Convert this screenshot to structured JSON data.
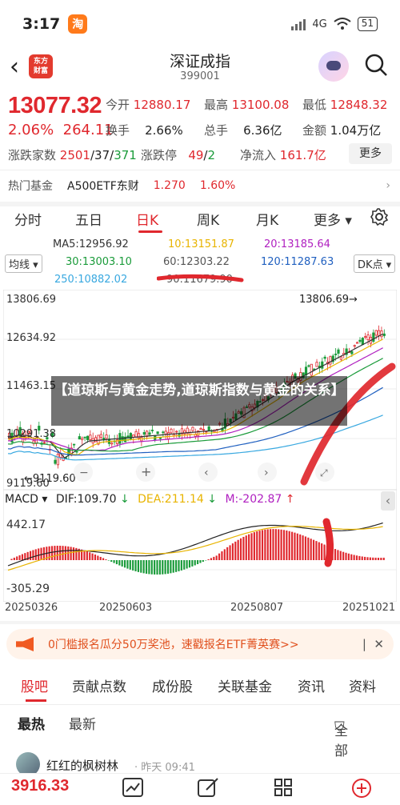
{
  "status": {
    "time": "3:17",
    "app_badge": "淘",
    "network": "4G",
    "battery": "51"
  },
  "nav": {
    "title": "深证成指",
    "code": "399001",
    "logo_text": "东方财富"
  },
  "quote": {
    "price": "13077.32",
    "change_pct": "2.06%",
    "change": "264.11",
    "open_label": "今开",
    "open": "12880.17",
    "high_label": "最高",
    "high": "13100.08",
    "low_label": "最低",
    "low": "12848.32",
    "turnover_label": "换手",
    "turnover": "2.66%",
    "volume_label": "总手",
    "volume": "6.36亿",
    "amount_label": "金额",
    "amount": "1.04万亿",
    "breadth_label": "涨跌家数",
    "breadth_up": "2501",
    "breadth_flat": "37",
    "breadth_down": "371",
    "limit_label": "涨跌停",
    "limit_up": "49",
    "limit_down": "2",
    "inflow_label": "净流入",
    "inflow": "161.7亿",
    "more_label": "更多"
  },
  "fund": {
    "label": "热门基金",
    "name": "A500ETF东财",
    "price": "1.270",
    "pct": "1.60%"
  },
  "tabs": [
    "分时",
    "五日",
    "日K",
    "周K",
    "月K",
    "更多"
  ],
  "ma": {
    "selector": "均线",
    "ma5": "MA5:12956.92",
    "ma10": "10:13151.87",
    "ma20": "20:13185.64",
    "ma30": "30:13003.10",
    "ma60": "60:12303.22",
    "ma120": "120:11287.63",
    "ma250": "250:10882.02",
    "ma90": "90:11679.90",
    "dk": "DK点"
  },
  "kchart": {
    "y_labels": [
      "13806.69",
      "12634.92",
      "11463.15",
      "10291.38",
      "9119.60"
    ],
    "high_label": "13806.69",
    "low_label": "9119.60"
  },
  "macd": {
    "selector": "MACD",
    "dif": "DIF:109.70",
    "dea": "DEA:211.14",
    "m": "M:-202.87",
    "top": "442.17",
    "bottom": "-305.29"
  },
  "dates": [
    "20250326",
    "20250603",
    "20250807",
    "20251021"
  ],
  "overlay": {
    "title": "【道琼斯与黄金走势,道琼斯指数与黄金的关系】"
  },
  "promo": {
    "text": "0门槛报名瓜分50万奖池，速戳报名ETF菁英赛>>"
  },
  "sub_tabs": [
    "股吧",
    "贡献点数",
    "成份股",
    "关联基金",
    "资讯",
    "资料"
  ],
  "filter": {
    "hot": "最热",
    "new": "最新",
    "all": "全部"
  },
  "post": {
    "user": "红红的枫树林",
    "time": "· 昨天 09:41"
  },
  "bottom": {
    "price": "3916.33"
  },
  "colors": {
    "up": "#e0282e",
    "down": "#1a9b3a"
  }
}
